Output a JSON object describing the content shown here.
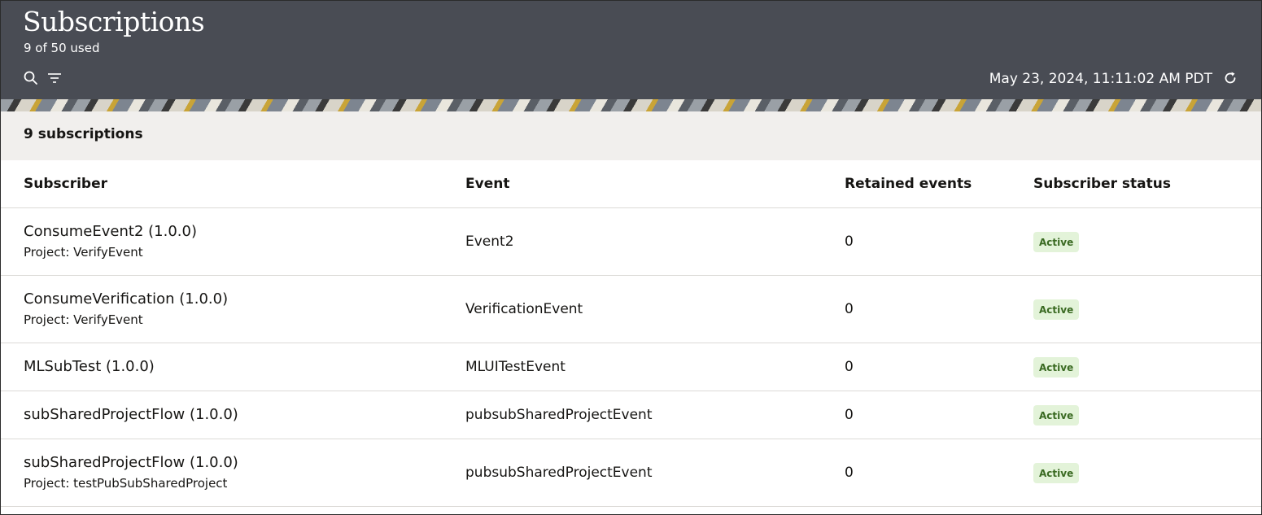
{
  "header": {
    "title": "Subscriptions",
    "usage": "9 of 50 used",
    "timestamp": "May 23, 2024, 11:11:02 AM PDT",
    "icons": [
      "search-icon",
      "filter-icon",
      "refresh-icon"
    ]
  },
  "summary": {
    "count_label": "9 subscriptions"
  },
  "table": {
    "columns": [
      "Subscriber",
      "Event",
      "Retained events",
      "Subscriber status"
    ],
    "rows": [
      {
        "subscriber": "ConsumeEvent2 (1.0.0)",
        "project": "Project: VerifyEvent",
        "event": "Event2",
        "retained": "0",
        "status": "Active"
      },
      {
        "subscriber": "ConsumeVerification (1.0.0)",
        "project": "Project: VerifyEvent",
        "event": "VerificationEvent",
        "retained": "0",
        "status": "Active"
      },
      {
        "subscriber": "MLSubTest (1.0.0)",
        "project": "",
        "event": "MLUITestEvent",
        "retained": "0",
        "status": "Active"
      },
      {
        "subscriber": "subSharedProjectFlow (1.0.0)",
        "project": "",
        "event": "pubsubSharedProjectEvent",
        "retained": "0",
        "status": "Active"
      },
      {
        "subscriber": "subSharedProjectFlow (1.0.0)",
        "project": "Project: testPubSubSharedProject",
        "event": "pubsubSharedProjectEvent",
        "retained": "0",
        "status": "Active"
      }
    ]
  },
  "colors": {
    "header_bg": "#494c54",
    "summary_bg": "#f1efed",
    "badge_bg": "#e3f3d9",
    "badge_text": "#3a6a22"
  }
}
